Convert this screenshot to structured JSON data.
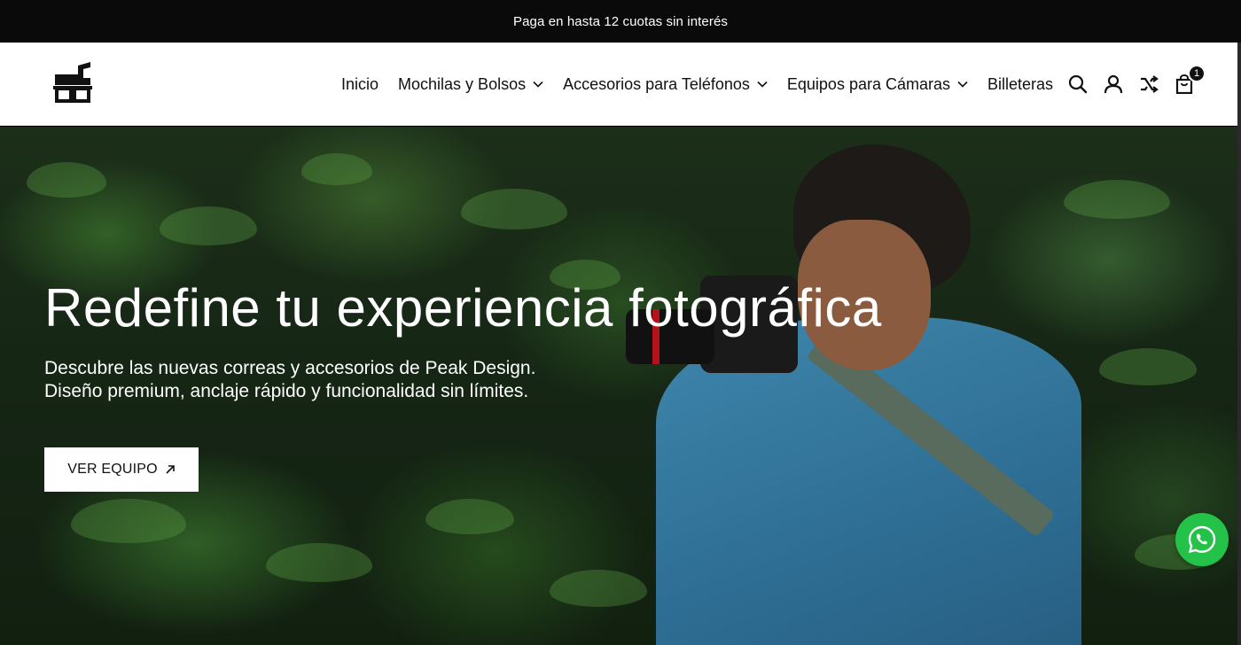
{
  "announcement": {
    "text": "Paga en hasta 12 cuotas sin interés"
  },
  "header": {
    "logo_icon": "store-logo",
    "nav": [
      {
        "label": "Inicio",
        "dropdown": false
      },
      {
        "label": "Mochilas y Bolsos",
        "dropdown": true
      },
      {
        "label": "Accesorios para Teléfonos",
        "dropdown": true
      },
      {
        "label": "Equipos para Cámaras",
        "dropdown": true
      },
      {
        "label": "Billeteras",
        "dropdown": false
      }
    ],
    "icons": [
      "search-icon",
      "account-icon",
      "shuffle-icon",
      "cart-icon"
    ],
    "cart_count": "1"
  },
  "hero": {
    "title": "Redefine tu experiencia fotográfica",
    "subtitle_line1": "Descubre las nuevas correas y accesorios de Peak Design.",
    "subtitle_line2": "Diseño premium, anclaje rápido y funcionalidad sin límites.",
    "cta_label": "VER EQUIPO",
    "cta_icon": "arrow-up-right-icon"
  },
  "floating": {
    "whatsapp_icon": "whatsapp-icon",
    "whatsapp_color": "#25c24a"
  },
  "colors": {
    "announcement_bg": "#0a0a0a",
    "header_bg": "#ffffff",
    "cta_bg": "#ffffff"
  }
}
